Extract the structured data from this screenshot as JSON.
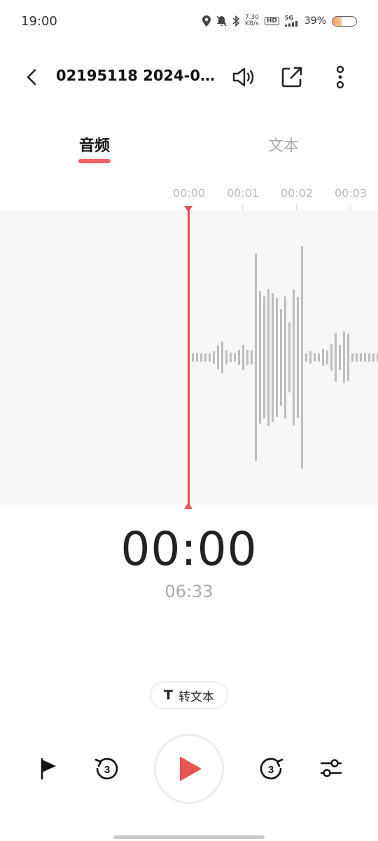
{
  "status": {
    "time": "19:00",
    "speed_value": "7.30",
    "speed_unit": "KB/s",
    "hd": "HD",
    "network": "5G",
    "battery_pct": "39%",
    "battery_level": 0.39
  },
  "header": {
    "title": "02195118 2024-08..."
  },
  "tabs": [
    {
      "label": "音频",
      "active": true
    },
    {
      "label": "文本",
      "active": false
    }
  ],
  "ruler": {
    "ticks": [
      "00:00",
      "00:01",
      "00:02",
      "00:03"
    ]
  },
  "playback": {
    "current_time": "00:00",
    "total_time": "06:33"
  },
  "transcribe": {
    "icon": "T",
    "label": "转文本"
  },
  "controls": {
    "flag_icon": "flag-icon",
    "rewind_icon": "rewind-3s-icon",
    "rewind_seconds": "3",
    "play_icon": "play-icon",
    "forward_icon": "forward-3s-icon",
    "forward_seconds": "3",
    "settings_icon": "equalizer-icon"
  },
  "colors": {
    "accent": "#e85454",
    "waveform": "#bdbdbd",
    "wave_bg": "#f7f7f7"
  }
}
